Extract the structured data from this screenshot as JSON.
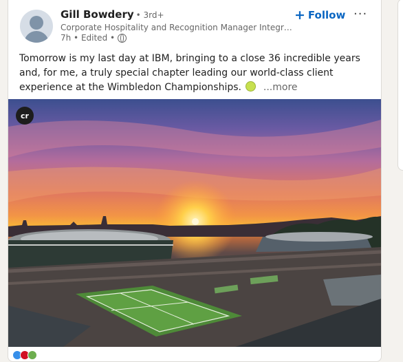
{
  "post": {
    "author": {
      "name": "Gill Bowdery",
      "degree": "• 3rd+",
      "headline": "Corporate Hospitality and Recognition Manager Integrat...",
      "meta": "7h • Edited •"
    },
    "follow_label": "Follow",
    "more_menu": "···",
    "text": "Tomorrow is my last day at IBM, bringing to a close 36 incredible years and, for me, a truly special chapter leading our world-class client experience at the Wimbledon Championships.",
    "see_more": "...more",
    "image_badge": "cr"
  },
  "colors": {
    "link_blue": "#0a66c2",
    "text_primary": "#1f1f1f",
    "text_secondary": "#666666",
    "page_bg": "#f4f2ee"
  },
  "icons": [
    "globe-icon",
    "tennis-ball-icon",
    "plus-icon",
    "ellipsis-icon"
  ]
}
